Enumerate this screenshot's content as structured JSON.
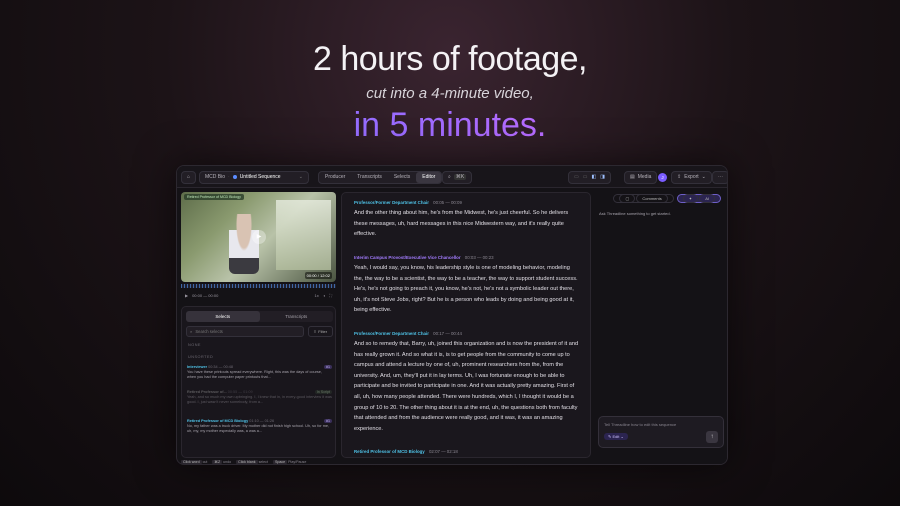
{
  "hero": {
    "line1": "2 hours of footage,",
    "line2": "cut into a 4-minute video,",
    "line3": "in 5 minutes."
  },
  "topbar": {
    "project": "MCD Bio",
    "sequence": "Untitled Sequence",
    "tabs": [
      "Producer",
      "Transcripts",
      "Selects",
      "Editor"
    ],
    "active_tab": "Editor",
    "search_shortcut": "⌘K",
    "media_label": "Media",
    "export_label": "Export",
    "avatar_initial": "J"
  },
  "video": {
    "badge": "Retired Professor of MCD Biology",
    "time": "00:00 / 12:02",
    "control_time": "00:00 — 00:00"
  },
  "panel": {
    "tabs": [
      "Selects",
      "Transcripts"
    ],
    "search_placeholder": "Search selects",
    "filter_label": "Filter",
    "section_none": "NONE",
    "section_unsorted": "UNSORTED",
    "clips": [
      {
        "name": "Interviewer",
        "meta": "00:34 — 00:48",
        "tag": "#1",
        "text": "You have these printouts spread everywhere. Right, this was the days of course, when you had the computer paper printouts that..."
      },
      {
        "name": "Retired Professor of...",
        "meta": "00:55 — 01:09",
        "tag": "In Script",
        "text": "Yeah, and so much my own upbringing. I, I knew that in, in every-good interview it was good. I, just wasn't never somebody, from a..."
      },
      {
        "name": "Retired Professor of MCD Biology",
        "meta": "01:10 — 01:26",
        "tag": "#1",
        "text": "No, my father was a truck driver. My mother did not finish high school. Uh, so for me, uh, my, my mother especially was, a was a..."
      }
    ]
  },
  "transcript": [
    {
      "speaker": "Professor/Former Department Chair",
      "timecode": "00:05 — 00:09",
      "color": "#4fc3e8",
      "text": "And the other thing about him, he's from the Midwest, he's just cheerful. So he delivers these messages, uh, hard messages in this nice Midwestern way, and it's really quite effective."
    },
    {
      "speaker": "Interim Campus Provost/Executive Vice Chancellor",
      "timecode": "00:03 — 00:23",
      "color": "#a37cff",
      "text": "Yeah, I would say, you know, his leadership style is one of modeling behavior, modeling the, the way to be a scientist, the way to be a teacher, the way to support student success. He's, he's not going to preach it, you know, he's not, he's not a symbolic leader out there, uh, it's not Steve Jobs, right? But he is a person who leads by doing and being good at it, being effective."
    },
    {
      "speaker": "Professor/Former Department Chair",
      "timecode": "00:17 — 00:44",
      "color": "#4fc3e8",
      "text": "And so to remedy that, Barry, uh, joined this organization and is now the president of it and has really grown it. And so what it is, is to get people from the community to come up to campus and attend a lecture by one of, uh, prominent researchers from the, from the university. And, um, they'll put it in lay terms. Uh, I was fortunate enough to be able to participate and be invited to participate in one. And it was actually pretty amazing. First of all, uh, how many people attended. There were hundreds, which I, I thought it would be a group of 10 to 20. The other thing about it is at the end, uh, the questions both from faculty that attended and from the audience were really good, and it was, it was an amazing experience."
    },
    {
      "speaker": "Retired Professor of MCD Biology",
      "timecode": "02:07 — 02:18",
      "color": "#4fc3e8",
      "text": ""
    }
  ],
  "assistant": {
    "tabs": [
      "Comments",
      "AI"
    ],
    "active_tab": "AI",
    "hint": "Ask Threadline something to get started.",
    "placeholder": "Tell Threadline how to edit this sequence",
    "edit_label": "Edit"
  },
  "footer": {
    "items": [
      {
        "key": "Click word",
        "label": "cut"
      },
      {
        "key": "⌘Z",
        "label": "undo"
      },
      {
        "key": "Click blank",
        "label": "select"
      },
      {
        "key": "Space",
        "label": "Play/Pause"
      }
    ]
  }
}
